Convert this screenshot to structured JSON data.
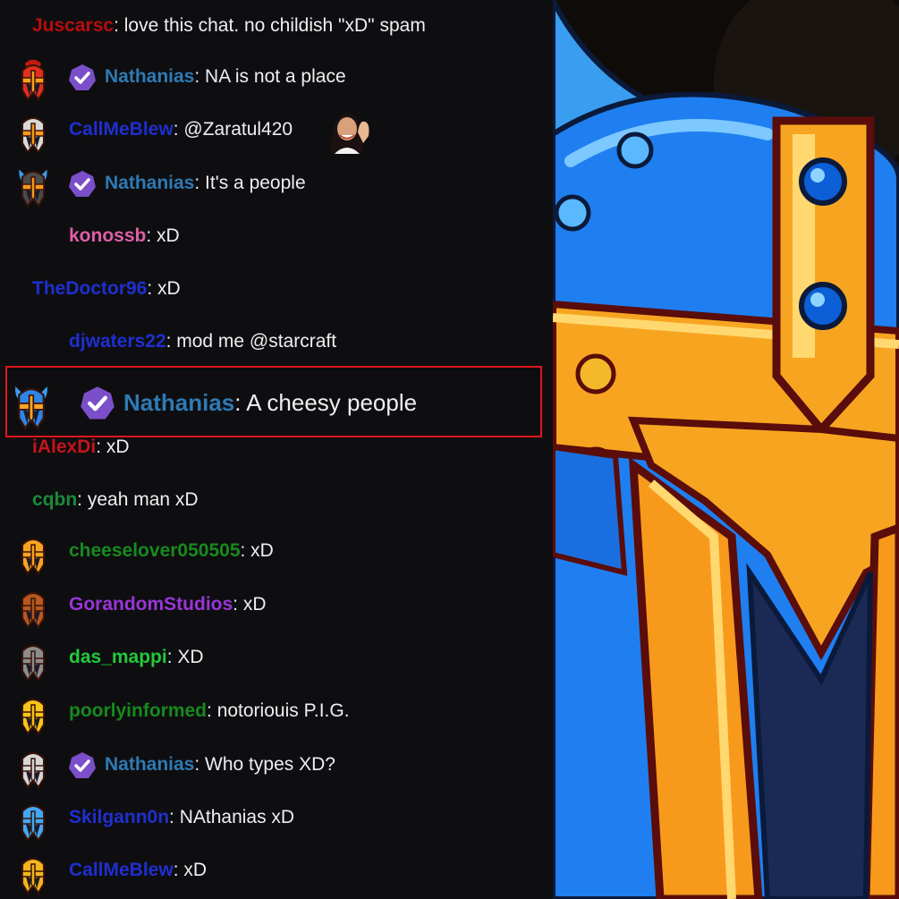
{
  "chat": {
    "messages": [
      {
        "user": "Juscarsc",
        "text": "love this chat. no childish \"xD\" spam",
        "color": "#b80c0c",
        "avatar": null,
        "verified": false,
        "indent": false
      },
      {
        "user": "Nathanias",
        "text": "NA is not a place",
        "color": "#2e7ab4",
        "avatar": "red-spartan-helmet",
        "verified": true,
        "indent": true
      },
      {
        "user": "CallMeBlew",
        "text": "@Zaratul420",
        "color": "#1f2fd0",
        "avatar": "silver-knight-helmet",
        "verified": false,
        "indent": true,
        "emote": "waving-woman-emote"
      },
      {
        "user": "Nathanias",
        "text": "It's a people",
        "color": "#2e7ab4",
        "avatar": "horned-viking-helmet",
        "verified": true,
        "indent": true
      },
      {
        "user": "konossb",
        "text": "xD",
        "color": "#e05ea8",
        "avatar": null,
        "verified": false,
        "indent": true
      },
      {
        "user": "TheDoctor96",
        "text": "xD",
        "color": "#1f2fd0",
        "avatar": null,
        "verified": false,
        "indent": false
      },
      {
        "user": "djwaters22",
        "text": "mod me @starcraft",
        "color": "#1f2fd0",
        "avatar": null,
        "verified": false,
        "indent": true
      },
      {
        "user": "Nathanias",
        "text": "A cheesy people",
        "color": "#2e7ab4",
        "avatar": "blue-viking-helmet",
        "verified": true,
        "indent": true,
        "highlighted": true
      },
      {
        "user": "iAlexDi",
        "text": "xD",
        "color": "#c4151a",
        "avatar": null,
        "verified": false,
        "indent": false
      },
      {
        "user": "cqbn",
        "text": "yeah man xD",
        "color": "#1a8a3a",
        "avatar": null,
        "verified": false,
        "indent": false
      },
      {
        "user": "cheeselover050505",
        "text": "xD",
        "color": "#178a1e",
        "avatar": "gold-helmet",
        "verified": false,
        "indent": true
      },
      {
        "user": "GorandomStudios",
        "text": "xD",
        "color": "#9a35d8",
        "avatar": "bronze-helmet",
        "verified": false,
        "indent": true
      },
      {
        "user": "das_mappi",
        "text": "XD",
        "color": "#22c93a",
        "avatar": "gray-helmet",
        "verified": false,
        "indent": true
      },
      {
        "user": "poorlyinformed",
        "text": "notoriouis P.I.G.",
        "color": "#178a1e",
        "avatar": "yellow-helmet",
        "verified": false,
        "indent": true
      },
      {
        "user": "Nathanias",
        "text": "Who types XD?",
        "color": "#2e7ab4",
        "avatar": "silver-helmet",
        "verified": true,
        "indent": true
      },
      {
        "user": "Skilgann0n",
        "text": "NAthanias xD",
        "color": "#1f2fd0",
        "avatar": "blue-helmet",
        "verified": false,
        "indent": true
      },
      {
        "user": "CallMeBlew",
        "text": "xD",
        "color": "#1f2fd0",
        "avatar": "small-gold-helmet",
        "verified": false,
        "indent": true
      }
    ]
  },
  "art": {
    "icon": "viking-helmet-logo"
  },
  "colors": {
    "chat_bg": "#0e0e10",
    "message_text": "#efeff1",
    "highlight_border": "#e0161c",
    "verified_badge": "#7b4fc9"
  }
}
